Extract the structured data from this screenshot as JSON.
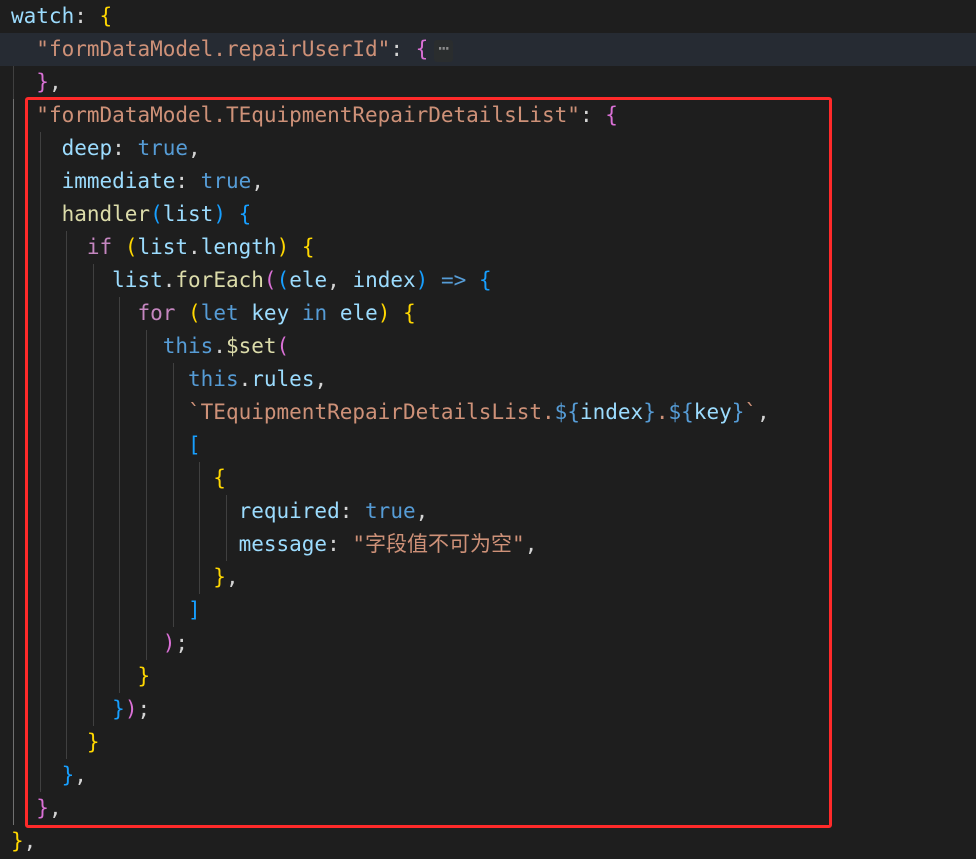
{
  "editor": {
    "theme_colors": {
      "background": "#1e1e1e",
      "highlight_box": "#ff2a2a",
      "keyword_control": "#c586c0",
      "keyword_declaration": "#569cd6",
      "property": "#9cdcfe",
      "function": "#dcdcaa",
      "string": "#ce9178",
      "bracket_level_1": "#ffd700",
      "bracket_level_2": "#da70d6",
      "bracket_level_3": "#179fff"
    },
    "folded_region_marker": "⋯",
    "highlight_box_label": "red highlight rectangle around TEquipmentRepairDetailsList watcher",
    "lines": [
      {
        "tokens": [
          {
            "t": "watch",
            "c": "prop"
          },
          {
            "t": ": ",
            "c": "punct"
          },
          {
            "t": "{",
            "c": "b1"
          }
        ]
      },
      {
        "tokens": [
          {
            "t": "  ",
            "c": "punct"
          },
          {
            "t": "\"formDataModel.repairUserId\"",
            "c": "str"
          },
          {
            "t": ": ",
            "c": "punct"
          },
          {
            "t": "{",
            "c": "b2"
          }
        ],
        "folded": true
      },
      {
        "tokens": [
          {
            "t": "  ",
            "c": "punct"
          },
          {
            "t": "}",
            "c": "b2"
          },
          {
            "t": ",",
            "c": "punct"
          }
        ]
      },
      {
        "tokens": [
          {
            "t": "  ",
            "c": "punct"
          },
          {
            "t": "\"formDataModel.TEquipmentRepairDetailsList\"",
            "c": "str"
          },
          {
            "t": ": ",
            "c": "punct"
          },
          {
            "t": "{",
            "c": "b2"
          }
        ]
      },
      {
        "tokens": [
          {
            "t": "    ",
            "c": "punct"
          },
          {
            "t": "deep",
            "c": "prop"
          },
          {
            "t": ": ",
            "c": "punct"
          },
          {
            "t": "true",
            "c": "kw-decl"
          },
          {
            "t": ",",
            "c": "punct"
          }
        ]
      },
      {
        "tokens": [
          {
            "t": "    ",
            "c": "punct"
          },
          {
            "t": "immediate",
            "c": "prop"
          },
          {
            "t": ": ",
            "c": "punct"
          },
          {
            "t": "true",
            "c": "kw-decl"
          },
          {
            "t": ",",
            "c": "punct"
          }
        ]
      },
      {
        "tokens": [
          {
            "t": "    ",
            "c": "punct"
          },
          {
            "t": "handler",
            "c": "fn"
          },
          {
            "t": "(",
            "c": "b3"
          },
          {
            "t": "list",
            "c": "prop"
          },
          {
            "t": ")",
            "c": "b3"
          },
          {
            "t": " ",
            "c": "punct"
          },
          {
            "t": "{",
            "c": "b3"
          }
        ]
      },
      {
        "tokens": [
          {
            "t": "      ",
            "c": "punct"
          },
          {
            "t": "if",
            "c": "kw-ctrl"
          },
          {
            "t": " ",
            "c": "punct"
          },
          {
            "t": "(",
            "c": "b1"
          },
          {
            "t": "list",
            "c": "prop"
          },
          {
            "t": ".",
            "c": "punct"
          },
          {
            "t": "length",
            "c": "prop"
          },
          {
            "t": ")",
            "c": "b1"
          },
          {
            "t": " ",
            "c": "punct"
          },
          {
            "t": "{",
            "c": "b1"
          }
        ]
      },
      {
        "tokens": [
          {
            "t": "        ",
            "c": "punct"
          },
          {
            "t": "list",
            "c": "prop"
          },
          {
            "t": ".",
            "c": "punct"
          },
          {
            "t": "forEach",
            "c": "fn"
          },
          {
            "t": "(",
            "c": "b2"
          },
          {
            "t": "(",
            "c": "b3"
          },
          {
            "t": "ele",
            "c": "prop"
          },
          {
            "t": ", ",
            "c": "punct"
          },
          {
            "t": "index",
            "c": "prop"
          },
          {
            "t": ")",
            "c": "b3"
          },
          {
            "t": " ",
            "c": "punct"
          },
          {
            "t": "=>",
            "c": "kw-decl"
          },
          {
            "t": " ",
            "c": "punct"
          },
          {
            "t": "{",
            "c": "b3"
          }
        ]
      },
      {
        "tokens": [
          {
            "t": "          ",
            "c": "punct"
          },
          {
            "t": "for",
            "c": "kw-ctrl"
          },
          {
            "t": " ",
            "c": "punct"
          },
          {
            "t": "(",
            "c": "b1"
          },
          {
            "t": "let",
            "c": "kw-decl"
          },
          {
            "t": " ",
            "c": "punct"
          },
          {
            "t": "key",
            "c": "prop"
          },
          {
            "t": " ",
            "c": "punct"
          },
          {
            "t": "in",
            "c": "kw-decl"
          },
          {
            "t": " ",
            "c": "punct"
          },
          {
            "t": "ele",
            "c": "prop"
          },
          {
            "t": ")",
            "c": "b1"
          },
          {
            "t": " ",
            "c": "punct"
          },
          {
            "t": "{",
            "c": "b1"
          }
        ]
      },
      {
        "tokens": [
          {
            "t": "            ",
            "c": "punct"
          },
          {
            "t": "this",
            "c": "kw-decl"
          },
          {
            "t": ".",
            "c": "punct"
          },
          {
            "t": "$set",
            "c": "fn"
          },
          {
            "t": "(",
            "c": "b2"
          }
        ]
      },
      {
        "tokens": [
          {
            "t": "              ",
            "c": "punct"
          },
          {
            "t": "this",
            "c": "kw-decl"
          },
          {
            "t": ".",
            "c": "punct"
          },
          {
            "t": "rules",
            "c": "prop"
          },
          {
            "t": ",",
            "c": "punct"
          }
        ]
      },
      {
        "tokens": [
          {
            "t": "              ",
            "c": "punct"
          },
          {
            "t": "`TEquipmentRepairDetailsList.",
            "c": "str"
          },
          {
            "t": "${",
            "c": "kw-decl"
          },
          {
            "t": "index",
            "c": "prop"
          },
          {
            "t": "}",
            "c": "kw-decl"
          },
          {
            "t": ".",
            "c": "str"
          },
          {
            "t": "${",
            "c": "kw-decl"
          },
          {
            "t": "key",
            "c": "prop"
          },
          {
            "t": "}",
            "c": "kw-decl"
          },
          {
            "t": "`",
            "c": "str"
          },
          {
            "t": ",",
            "c": "punct"
          }
        ]
      },
      {
        "tokens": [
          {
            "t": "              ",
            "c": "punct"
          },
          {
            "t": "[",
            "c": "b3"
          }
        ]
      },
      {
        "tokens": [
          {
            "t": "                ",
            "c": "punct"
          },
          {
            "t": "{",
            "c": "b1"
          }
        ]
      },
      {
        "tokens": [
          {
            "t": "                  ",
            "c": "punct"
          },
          {
            "t": "required",
            "c": "prop"
          },
          {
            "t": ": ",
            "c": "punct"
          },
          {
            "t": "true",
            "c": "kw-decl"
          },
          {
            "t": ",",
            "c": "punct"
          }
        ]
      },
      {
        "tokens": [
          {
            "t": "                  ",
            "c": "punct"
          },
          {
            "t": "message",
            "c": "prop"
          },
          {
            "t": ": ",
            "c": "punct"
          },
          {
            "t": "\"字段值不可为空\"",
            "c": "str"
          },
          {
            "t": ",",
            "c": "punct"
          }
        ]
      },
      {
        "tokens": [
          {
            "t": "                ",
            "c": "punct"
          },
          {
            "t": "}",
            "c": "b1"
          },
          {
            "t": ",",
            "c": "punct"
          }
        ]
      },
      {
        "tokens": [
          {
            "t": "              ",
            "c": "punct"
          },
          {
            "t": "]",
            "c": "b3"
          }
        ]
      },
      {
        "tokens": [
          {
            "t": "            ",
            "c": "punct"
          },
          {
            "t": ")",
            "c": "b2"
          },
          {
            "t": ";",
            "c": "punct"
          }
        ]
      },
      {
        "tokens": [
          {
            "t": "          ",
            "c": "punct"
          },
          {
            "t": "}",
            "c": "b1"
          }
        ]
      },
      {
        "tokens": [
          {
            "t": "        ",
            "c": "punct"
          },
          {
            "t": "}",
            "c": "b3"
          },
          {
            "t": ")",
            "c": "b2"
          },
          {
            "t": ";",
            "c": "punct"
          }
        ]
      },
      {
        "tokens": [
          {
            "t": "      ",
            "c": "punct"
          },
          {
            "t": "}",
            "c": "b1"
          }
        ]
      },
      {
        "tokens": [
          {
            "t": "    ",
            "c": "punct"
          },
          {
            "t": "}",
            "c": "b3"
          },
          {
            "t": ",",
            "c": "punct"
          }
        ]
      },
      {
        "tokens": [
          {
            "t": "  ",
            "c": "punct"
          },
          {
            "t": "}",
            "c": "b2"
          },
          {
            "t": ",",
            "c": "punct"
          }
        ]
      },
      {
        "tokens": [
          {
            "t": "}",
            "c": "b1"
          },
          {
            "t": ",",
            "c": "punct"
          }
        ]
      }
    ]
  }
}
